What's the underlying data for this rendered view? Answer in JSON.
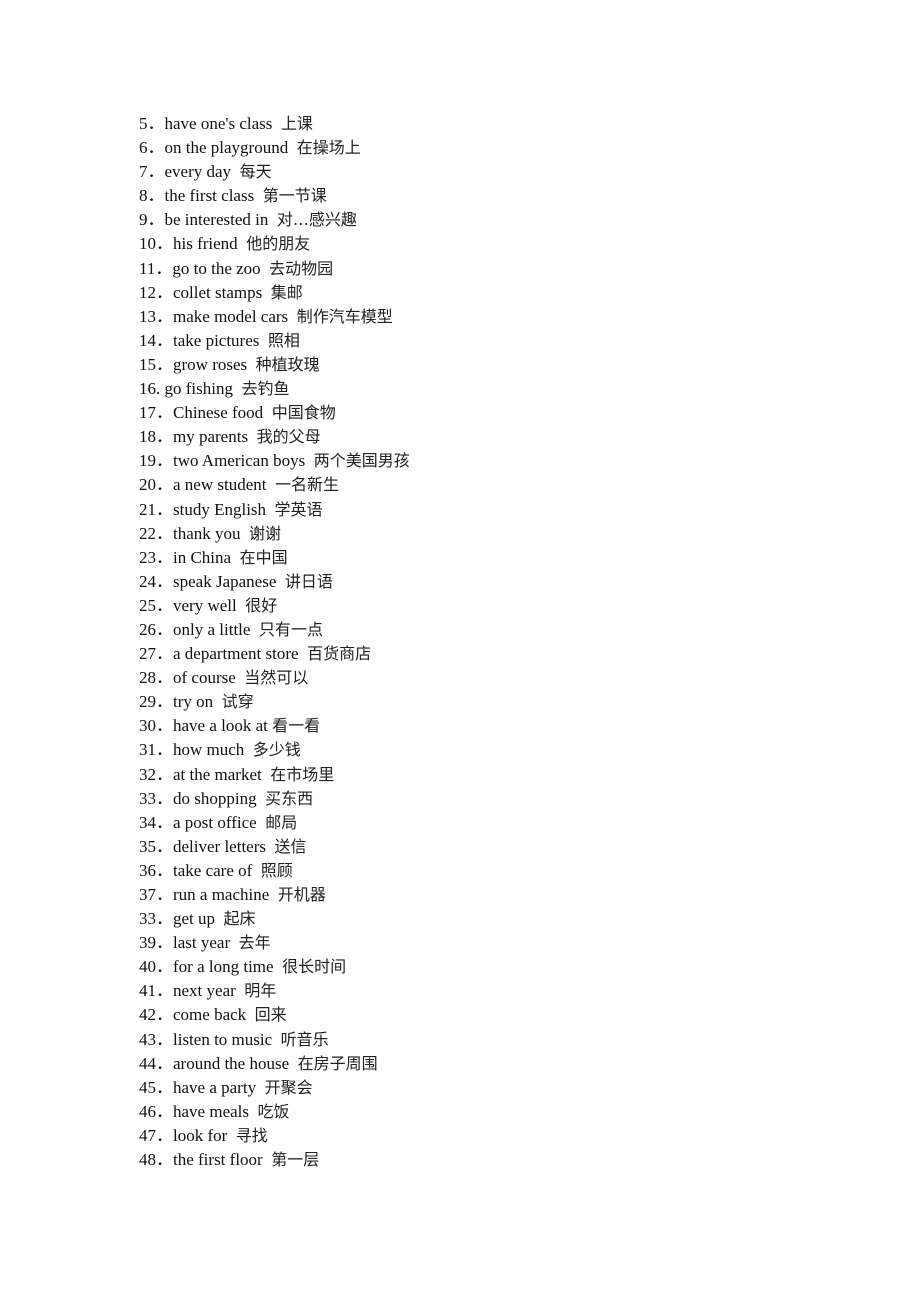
{
  "document": {
    "items": [
      {
        "num": "5．",
        "en": "have one's class",
        "sep": "  ",
        "zh": "上课"
      },
      {
        "num": "6．",
        "en": "on the playground",
        "sep": "  ",
        "zh": "在操场上"
      },
      {
        "num": "7．",
        "en": "every day",
        "sep": "  ",
        "zh": "每天"
      },
      {
        "num": "8．",
        "en": "the first class",
        "sep": "  ",
        "zh": "第一节课"
      },
      {
        "num": "9．",
        "en": "be interested in",
        "sep": "  ",
        "zh": "对…感兴趣"
      },
      {
        "num": "10．",
        "en": "his friend",
        "sep": "  ",
        "zh": "他的朋友"
      },
      {
        "num": "11．",
        "en": "go to the zoo",
        "sep": "  ",
        "zh": "去动物园"
      },
      {
        "num": "12．",
        "en": "collet stamps",
        "sep": "  ",
        "zh": "集邮"
      },
      {
        "num": "13．",
        "en": "make model cars",
        "sep": "  ",
        "zh": "制作汽车模型"
      },
      {
        "num": "14．",
        "en": "take pictures",
        "sep": "  ",
        "zh": "照相"
      },
      {
        "num": "15．",
        "en": "grow roses",
        "sep": "  ",
        "zh": "种植玫瑰"
      },
      {
        "num": "16. ",
        "en": "go fishing",
        "sep": "  ",
        "zh": "去钓鱼"
      },
      {
        "num": "17．",
        "en": "Chinese food",
        "sep": "  ",
        "zh": "中国食物"
      },
      {
        "num": "18．",
        "en": "my parents",
        "sep": "  ",
        "zh": "我的父母"
      },
      {
        "num": "19．",
        "en": "two American boys",
        "sep": "  ",
        "zh": "两个美国男孩"
      },
      {
        "num": "20．",
        "en": "a new student",
        "sep": "  ",
        "zh": "一名新生"
      },
      {
        "num": "21．",
        "en": "study English",
        "sep": "  ",
        "zh": "学英语"
      },
      {
        "num": "22．",
        "en": "thank you",
        "sep": "  ",
        "zh": "谢谢"
      },
      {
        "num": "23．",
        "en": "in China",
        "sep": "  ",
        "zh": "在中国"
      },
      {
        "num": "24．",
        "en": "speak Japanese",
        "sep": "  ",
        "zh": "讲日语"
      },
      {
        "num": "25．",
        "en": "very well",
        "sep": "  ",
        "zh": "很好"
      },
      {
        "num": "26．",
        "en": "only a little",
        "sep": "  ",
        "zh": "只有一点"
      },
      {
        "num": "27．",
        "en": "a department store",
        "sep": "  ",
        "zh": "百货商店"
      },
      {
        "num": "28．",
        "en": "of course",
        "sep": "  ",
        "zh": "当然可以"
      },
      {
        "num": "29．",
        "en": "try on",
        "sep": "  ",
        "zh": "试穿"
      },
      {
        "num": "30．",
        "en": "have a look at",
        "sep": " ",
        "zh": "看一看"
      },
      {
        "num": "31．",
        "en": "how much",
        "sep": "  ",
        "zh": "多少钱"
      },
      {
        "num": "32．",
        "en": "at the market",
        "sep": "  ",
        "zh": "在市场里"
      },
      {
        "num": "33．",
        "en": "do shopping",
        "sep": "  ",
        "zh": "买东西"
      },
      {
        "num": "34．",
        "en": "a post office",
        "sep": "  ",
        "zh": "邮局"
      },
      {
        "num": "35．",
        "en": "deliver letters",
        "sep": "  ",
        "zh": "送信"
      },
      {
        "num": "36．",
        "en": "take care of",
        "sep": "  ",
        "zh": "照顾"
      },
      {
        "num": "37．",
        "en": "run a machine",
        "sep": "  ",
        "zh": "开机器"
      },
      {
        "num": "33．",
        "en": "get up",
        "sep": "  ",
        "zh": "起床"
      },
      {
        "num": "39．",
        "en": "last year",
        "sep": "  ",
        "zh": "去年"
      },
      {
        "num": "40．",
        "en": "for a long time",
        "sep": "  ",
        "zh": "很长时间"
      },
      {
        "num": "41．",
        "en": "next year",
        "sep": "  ",
        "zh": "明年"
      },
      {
        "num": "42．",
        "en": "come back",
        "sep": "  ",
        "zh": "回来"
      },
      {
        "num": "43．",
        "en": "listen to music",
        "sep": "  ",
        "zh": "听音乐"
      },
      {
        "num": "44．",
        "en": "around the house",
        "sep": "  ",
        "zh": "在房子周围"
      },
      {
        "num": "45．",
        "en": "have a party",
        "sep": "  ",
        "zh": "开聚会"
      },
      {
        "num": "46．",
        "en": "have meals",
        "sep": "  ",
        "zh": "吃饭"
      },
      {
        "num": "47．",
        "en": "look for",
        "sep": "  ",
        "zh": "寻找"
      },
      {
        "num": "48．",
        "en": "the first floor",
        "sep": "  ",
        "zh": "第一层"
      }
    ]
  }
}
